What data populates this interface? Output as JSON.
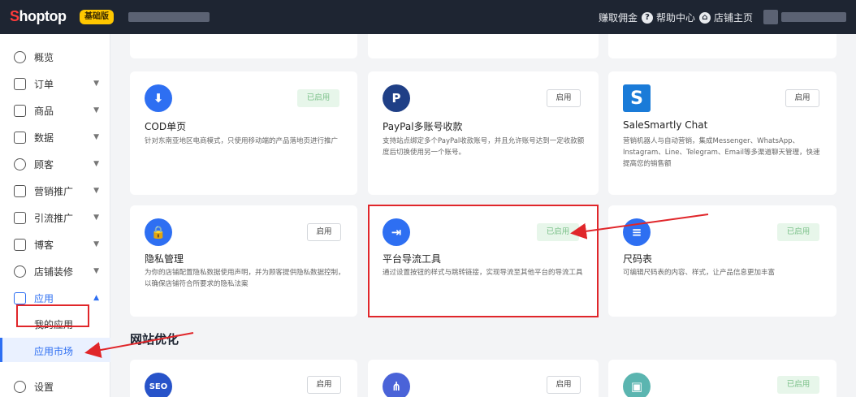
{
  "brand": {
    "logo_first": "S",
    "logo_rest": "hoptop",
    "plan_badge": "基础版"
  },
  "header": {
    "nav": [
      {
        "label": "赚取佣金"
      },
      {
        "label": "帮助中心"
      },
      {
        "label": "店铺主页"
      }
    ]
  },
  "sidebar": {
    "items": [
      {
        "label": "概览",
        "icon": "compass-icon"
      },
      {
        "label": "订单",
        "icon": "order-icon"
      },
      {
        "label": "商品",
        "icon": "product-icon"
      },
      {
        "label": "数据",
        "icon": "chart-icon"
      },
      {
        "label": "顾客",
        "icon": "user-icon"
      },
      {
        "label": "营销推广",
        "icon": "marketing-icon"
      },
      {
        "label": "引流推广",
        "icon": "traffic-icon"
      },
      {
        "label": "博客",
        "icon": "blog-icon"
      },
      {
        "label": "店铺装修",
        "icon": "decoration-icon"
      },
      {
        "label": "应用",
        "icon": "apps-icon"
      }
    ],
    "sub_items": [
      {
        "label": "我的应用"
      },
      {
        "label": "应用市场"
      }
    ],
    "settings": {
      "label": "设置",
      "icon": "gear-icon"
    }
  },
  "apps": [
    {
      "title": "COD单页",
      "desc": "针对东南亚地区电商模式，只使用移动端的产品落地页进行推广",
      "button": "已启用",
      "icon": "cod-icon",
      "icon_color": "#2e6ff2"
    },
    {
      "title": "PayPal多账号收款",
      "desc": "支持站点绑定多个PayPal收款账号，并且允许账号达到一定收款额度后切换使用另一个账号。",
      "button": "启用",
      "icon": "paypal-icon",
      "icon_color": "#1f3f86"
    },
    {
      "title": "SaleSmartly Chat",
      "desc": "营销机器人与自动营销，集成Messenger、WhatsApp、Instagram、Line、Telegram、Email等多渠道聊天管理，快速提高您的销售额",
      "button": "启用",
      "icon": "salesmartly-icon",
      "icon_color": "#1a7bd8"
    },
    {
      "title": "隐私管理",
      "desc": "为你的店铺配置隐私数据使用声明，并为顾客提供隐私数据控制，以确保店铺符合所要求的隐私法案",
      "button": "启用",
      "icon": "privacy-icon",
      "icon_color": "#2e6ff2"
    },
    {
      "title": "平台导流工具",
      "desc": "通过设置按钮的样式与跳转链接，实现导流至其他平台的导流工具",
      "button": "已启用",
      "icon": "redirect-icon",
      "icon_color": "#2e6ff2"
    },
    {
      "title": "尺码表",
      "desc": "可编辑尺码表的内容、样式，让产品信息更加丰富",
      "button": "已启用",
      "icon": "size-chart-icon",
      "icon_color": "#2e6ff2"
    }
  ],
  "section": {
    "title": "网站优化"
  },
  "bottom_apps": [
    {
      "button": "启用",
      "icon": "seo-icon",
      "icon_color": "#2753c9",
      "icon_text": "SEO"
    },
    {
      "button": "启用",
      "icon": "sitemap-icon",
      "icon_color": "#4a63d8"
    },
    {
      "button": "已启用",
      "icon": "image-icon",
      "icon_color": "#5bb5b0"
    }
  ]
}
